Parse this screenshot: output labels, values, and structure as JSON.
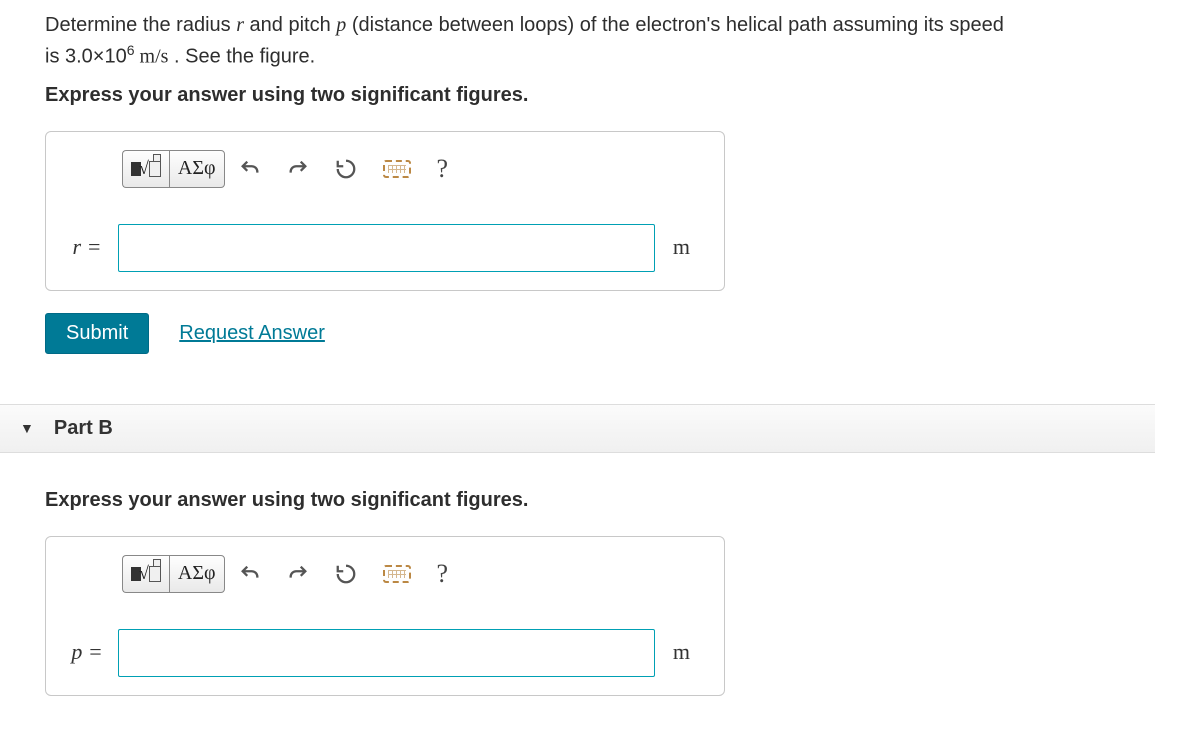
{
  "question": {
    "line1_pre": "Determine the radius ",
    "var_r": "r",
    "line1_mid": " and pitch ",
    "var_p": "p",
    "line1_post": " (distance between loops) of the electron's helical path assuming its speed",
    "line2_pre": "is 3.0×10",
    "exponent": "6",
    "line2_units": " m/s",
    "line2_post": " . See the figure."
  },
  "instruction": "Express your answer using two significant figures.",
  "toolbar": {
    "templates_label": "templates-button",
    "greek_label": "ΑΣφ",
    "undo": "undo",
    "redo": "redo",
    "reset": "reset",
    "keyboard": "keyboard",
    "help": "?"
  },
  "partA": {
    "var_label": "r =",
    "value": "",
    "unit": "m"
  },
  "submit_label": "Submit",
  "request_answer_label": "Request Answer",
  "partB": {
    "title": "Part B",
    "instruction": "Express your answer using two significant figures.",
    "var_label": "p =",
    "value": "",
    "unit": "m"
  }
}
